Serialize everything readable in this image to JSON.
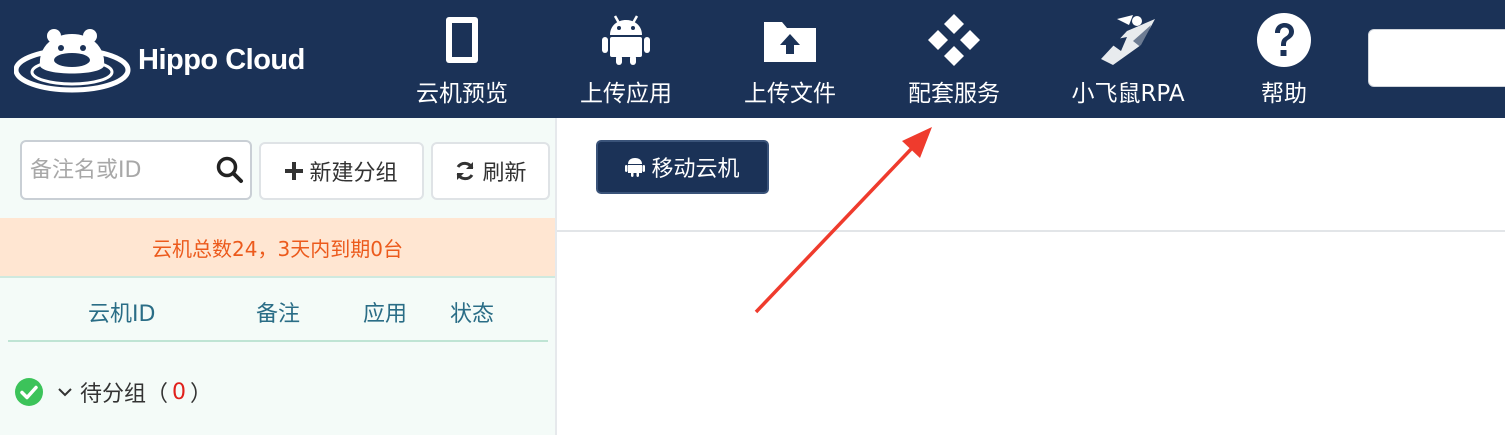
{
  "brand": {
    "name": "Hippo Cloud"
  },
  "nav": {
    "items": [
      {
        "label": "云机预览",
        "icon": "phone-icon"
      },
      {
        "label": "上传应用",
        "icon": "android-icon"
      },
      {
        "label": "上传文件",
        "icon": "folder-upload-icon"
      },
      {
        "label": "配套服务",
        "icon": "diamond-grid-icon"
      },
      {
        "label": "小飞鼠RPA",
        "icon": "flying-squirrel-icon"
      },
      {
        "label": "帮助",
        "icon": "help-icon"
      }
    ]
  },
  "sidebar": {
    "search": {
      "placeholder": "备注名或ID",
      "value": ""
    },
    "new_group_label": "新建分组",
    "refresh_label": "刷新",
    "notice": "云机总数24，3天内到期0台",
    "table": {
      "headers": [
        "云机ID",
        "备注",
        "应用",
        "状态"
      ]
    },
    "groups": [
      {
        "name": "待分组",
        "count_open": "（",
        "count": "0",
        "count_close": "）"
      }
    ]
  },
  "main": {
    "move_button_label": "移动云机"
  },
  "colors": {
    "nav_bg": "#1b3257",
    "notice_bg": "#ffe6d2",
    "notice_text": "#ec5a1c",
    "header_text": "#2a6d86",
    "status_ok": "#3cc35a",
    "count_red": "#e0201b",
    "arrow_red": "#ef3b2d"
  }
}
